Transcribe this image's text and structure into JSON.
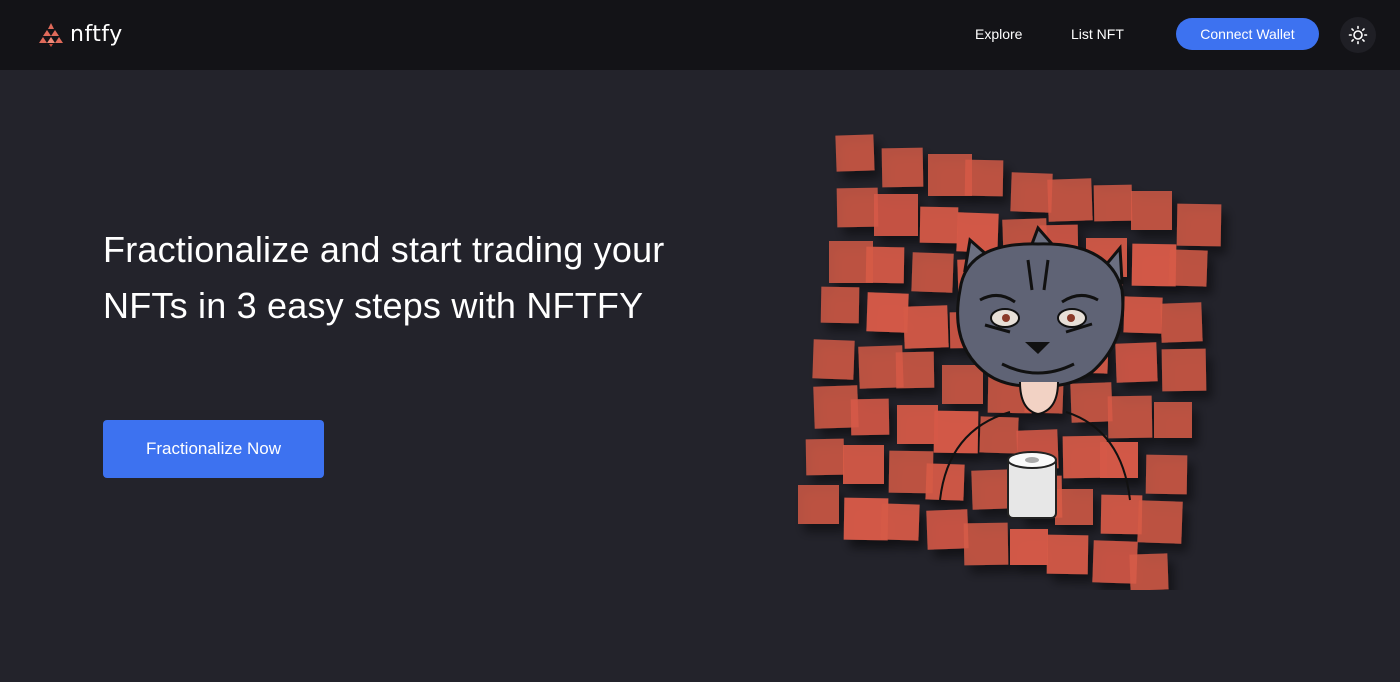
{
  "header": {
    "logo_text": "nftfy",
    "logo_icon": "nftfy-logo-icon",
    "nav": [
      {
        "label": "Explore"
      },
      {
        "label": "List NFT"
      }
    ],
    "connect_wallet_label": "Connect Wallet",
    "theme_toggle_icon": "sun-icon"
  },
  "hero": {
    "title": "Fractionalize and start trading your NFTs in 3 easy steps with NFTFY",
    "cta_label": "Fractionalize Now",
    "image": "fractionalized-tiger-nft-illustration"
  },
  "colors": {
    "background": "#23232b",
    "header_background": "#131317",
    "accent": "#3d72f0",
    "tile": "#d65a47",
    "text": "#ffffff"
  }
}
